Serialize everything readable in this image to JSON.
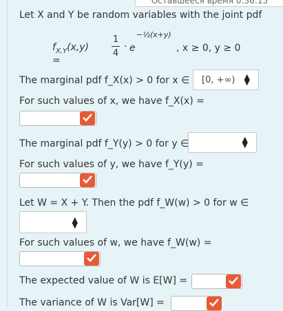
{
  "top_tab": "Оставшееся время 0:36:15",
  "intro": "Let X and Y be random variables with the joint pdf",
  "formula": {
    "lhs": "f",
    "sub": "X,Y",
    "args": "(x,y) =",
    "frac_num": "1",
    "frac_den": "4",
    "dot": "·",
    "e": "e",
    "exponent": "−½(x+y)",
    "condition": ",  x ≥ 0, y ≥ 0"
  },
  "q1": {
    "text": "The marginal pdf f_X(x) > 0 for x ∈",
    "select_value": "[0, +∞)",
    "sub_text": "For such values of x, we have f_X(x) ="
  },
  "q2": {
    "text": "The marginal pdf f_Y(y) > 0 for y ∈",
    "select_value": "",
    "sub_text": "For such values of y, we have f_Y(y) ="
  },
  "q3": {
    "text": "Let W = X + Y. Then the pdf f_W(w) > 0 for w ∈",
    "select_value": "",
    "sub_text": "For such values of w, we have f_W(w) ="
  },
  "q4": {
    "text": "The expected value of W is E[W] ="
  },
  "q5": {
    "text": "The variance of W is Var[W] ="
  },
  "colors": {
    "check": "#e85a35",
    "background": "#e6f3f7"
  }
}
